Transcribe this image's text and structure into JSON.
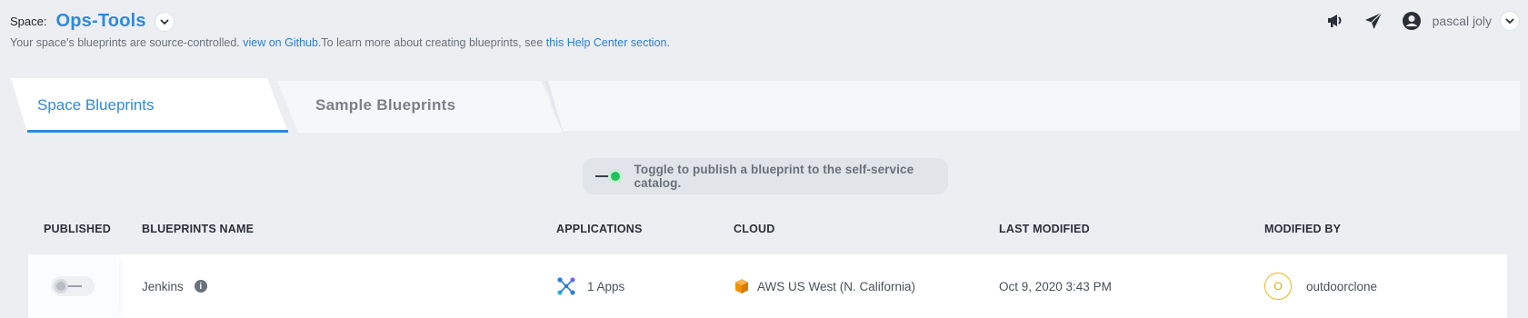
{
  "header": {
    "space_label": "Space:",
    "space_name": "Ops-Tools",
    "sub_prefix": "Your space's blueprints are source-controlled. ",
    "github_link": "view on Github",
    "sub_middle": ".To learn more about creating blueprints, see ",
    "help_link": "this Help Center section",
    "sub_suffix": ".",
    "user_name": "pascal joly"
  },
  "icons": {
    "announce": "megaphone-icon",
    "send": "paper-plane-icon",
    "user": "user-circle-icon",
    "chevron": "chevron-down-icon",
    "info": "info-icon",
    "apps": "apps-icon",
    "cloud": "aws-cube-icon"
  },
  "tabs": [
    {
      "label": "Space Blueprints",
      "active": true
    },
    {
      "label": "Sample Blueprints",
      "active": false
    }
  ],
  "hint": {
    "text": "Toggle to publish a blueprint to the self-service catalog."
  },
  "table": {
    "columns": [
      "PUBLISHED",
      "BLUEPRINTS NAME",
      "APPLICATIONS",
      "CLOUD",
      "LAST MODIFIED",
      "MODIFIED BY"
    ],
    "rows": [
      {
        "published": false,
        "name": "Jenkins",
        "applications": "1 Apps",
        "cloud": "AWS US West (N. California)",
        "last_modified": "Oct 9, 2020 3:43 PM",
        "modified_by_initial": "O",
        "modified_by": "outdoorclone"
      }
    ]
  },
  "colors": {
    "accent": "#2d8ae0",
    "toggle_on": "#21c25e",
    "avatar": "#f0b90b",
    "aws": "#f29100"
  }
}
